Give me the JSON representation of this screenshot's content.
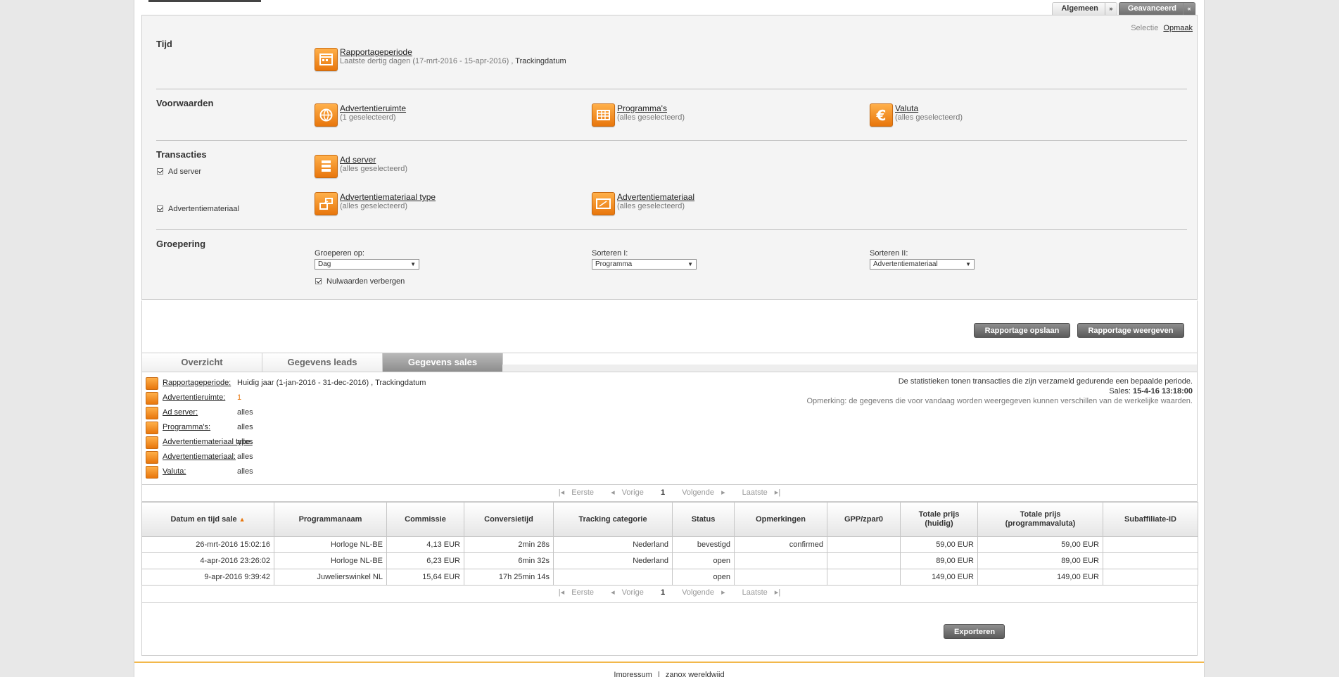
{
  "top_tabs": [
    {
      "label": "Algemeen",
      "arrow": "»"
    },
    {
      "label": "Geavanceerd",
      "arrow": "«"
    }
  ],
  "view_links": {
    "selectie": "Selectie",
    "opmaak": "Opmaak"
  },
  "sections": {
    "tijd": "Tijd",
    "voorwaarden": "Voorwaarden",
    "transacties": "Transacties",
    "groepering": "Groepering"
  },
  "criteria": {
    "rapportageperiode": {
      "label": "Rapportageperiode",
      "sub": "Laatste dertig dagen (17-mrt-2016 - 15-apr-2016) ,",
      "sub2": "Trackingdatum"
    },
    "advertentieruimte": {
      "label": "Advertentieruimte",
      "sub": "(1 geselecteerd)"
    },
    "programmas": {
      "label": "Programma's",
      "sub": "(alles geselecteerd)"
    },
    "valuta": {
      "label": "Valuta",
      "sub": "(alles geselecteerd)"
    },
    "ad_server": {
      "label": "Ad server",
      "sub": "(alles geselecteerd)"
    },
    "adv_type": {
      "label": "Advertentiemateriaal type",
      "sub": "(alles geselecteerd)"
    },
    "adv_mat": {
      "label": "Advertentiemateriaal",
      "sub": "(alles geselecteerd)"
    }
  },
  "checks": {
    "ad_server": "Ad server",
    "adv_mat": "Advertentiemateriaal",
    "nul": "Nulwaarden verbergen"
  },
  "grouping": {
    "groeperen_label": "Groeperen op:",
    "groeperen_value": "Dag",
    "sorteren1_label": "Sorteren I:",
    "sorteren1_value": "Programma",
    "sorteren2_label": "Sorteren II:",
    "sorteren2_value": "Advertentiemateriaal"
  },
  "buttons": {
    "opslaan": "Rapportage opslaan",
    "weergeven": "Rapportage weergeven",
    "exporteren": "Exporteren"
  },
  "result_tabs": [
    "Overzicht",
    "Gegevens leads",
    "Gegevens sales"
  ],
  "summary": [
    {
      "label": "Rapportageperiode:",
      "value": "Huidig jaar (1-jan-2016 - 31-dec-2016) , Trackingdatum"
    },
    {
      "label": "Advertentieruimte:",
      "value": "1"
    },
    {
      "label": "Ad server:",
      "value": "alles"
    },
    {
      "label": "Programma's:",
      "value": "alles"
    },
    {
      "label": "Advertentiemateriaal type:",
      "value": "alles"
    },
    {
      "label": "Advertentiemateriaal:",
      "value": "alles"
    },
    {
      "label": "Valuta:",
      "value": "alles"
    }
  ],
  "info": {
    "line1": "De statistieken tonen transacties die zijn verzameld gedurende een bepaalde periode.",
    "sales_label": "Sales:",
    "sales_value": "15-4-16 13:18:00",
    "note": "Opmerking: de gegevens die voor vandaag worden weergegeven kunnen verschillen van de werkelijke waarden."
  },
  "pager": {
    "first": "Eerste",
    "prev": "Vorige",
    "page": "1",
    "next": "Volgende",
    "last": "Laatste"
  },
  "table": {
    "headers": [
      "Datum en tijd sale",
      "Programmanaam",
      "Commissie",
      "Conversietijd",
      "Tracking categorie",
      "Status",
      "Opmerkingen",
      "GPP/zpar0",
      "Totale prijs\n(huidig)",
      "Totale prijs\n(programmavaluta)",
      "Subaffiliate-ID"
    ],
    "rows": [
      [
        "26-mrt-2016 15:02:16",
        "Horloge NL-BE",
        "4,13 EUR",
        "2min 28s",
        "Nederland",
        "bevestigd",
        "confirmed",
        "",
        "59,00 EUR",
        "59,00 EUR",
        ""
      ],
      [
        "4-apr-2016 23:26:02",
        "Horloge NL-BE",
        "6,23 EUR",
        "6min 32s",
        "Nederland",
        "open",
        "",
        "",
        "89,00 EUR",
        "89,00 EUR",
        ""
      ],
      [
        "9-apr-2016 9:39:42",
        "Juwelierswinkel NL",
        "15,64 EUR",
        "17h 25min 14s",
        "",
        "open",
        "",
        "",
        "149,00 EUR",
        "149,00 EUR",
        ""
      ]
    ]
  },
  "footer": {
    "impressum": "Impressum",
    "sep": "|",
    "wereldwijd": "zanox wereldwijd"
  },
  "colors": {
    "accent": "#e8760c",
    "button": "#6b6b6b"
  }
}
